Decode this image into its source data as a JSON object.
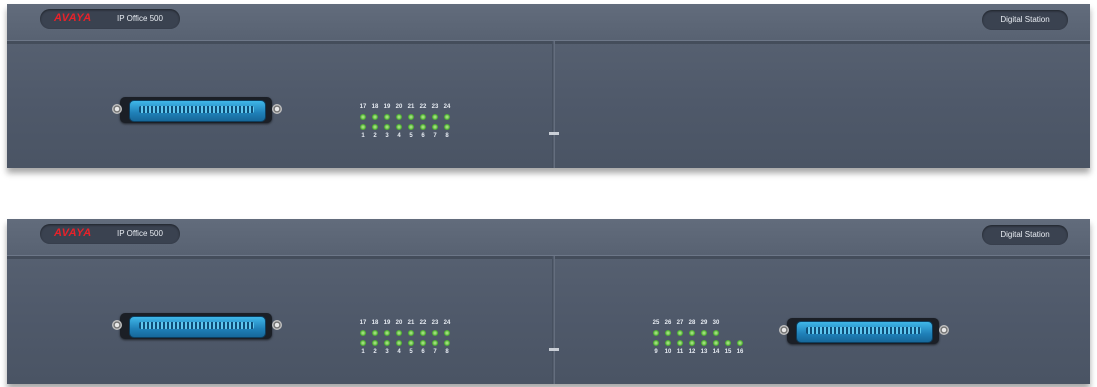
{
  "units": [
    {
      "brand_logo": "AVAYA",
      "model": "IP Office 500",
      "module_label": "Digital Station",
      "port_block_left": {
        "top_numbers": [
          "17",
          "18",
          "19",
          "20",
          "21",
          "22",
          "23",
          "24"
        ],
        "bottom_numbers": [
          "1",
          "2",
          "3",
          "4",
          "5",
          "6",
          "7",
          "8"
        ]
      }
    },
    {
      "brand_logo": "AVAYA",
      "model": "IP Office 500",
      "module_label": "Digital Station",
      "port_block_left": {
        "top_numbers": [
          "17",
          "18",
          "19",
          "20",
          "21",
          "22",
          "23",
          "24"
        ],
        "bottom_numbers": [
          "1",
          "2",
          "3",
          "4",
          "5",
          "6",
          "7",
          "8"
        ]
      },
      "port_block_right": {
        "top_numbers": [
          "25",
          "26",
          "27",
          "28",
          "29",
          "30"
        ],
        "bottom_numbers": [
          "9",
          "10",
          "11",
          "12",
          "13",
          "14",
          "15",
          "16"
        ]
      }
    }
  ],
  "colors": {
    "chassis": "#535d6d",
    "led_green": "#4caf2e",
    "logo_red": "#e8222a",
    "connector_blue": "#2a8fc8"
  }
}
